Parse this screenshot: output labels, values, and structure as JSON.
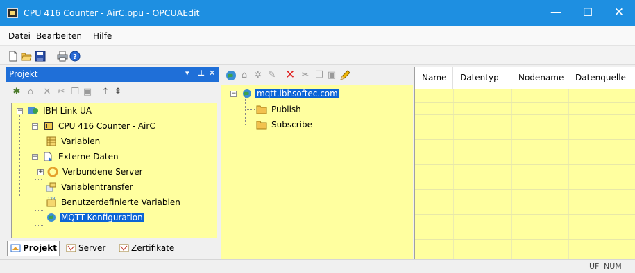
{
  "window": {
    "title": "CPU 416 Counter - AirC.opu - OPCUAEdit",
    "controls": {
      "minimize": "—",
      "maximize": "☐",
      "close": "✕"
    }
  },
  "menu": {
    "items": [
      "Datei",
      "Bearbeiten",
      "Hilfe"
    ]
  },
  "toolbar": {
    "icons": [
      "new-icon",
      "open-icon",
      "save-icon",
      "print-icon",
      "help-icon"
    ]
  },
  "project_pane": {
    "title": "Projekt",
    "header_buttons": [
      "▾",
      "⁴",
      "✕"
    ],
    "tree_toolbar_icons": [
      "new-item-icon",
      "add-folder-icon",
      "delete-icon",
      "cut-icon",
      "copy-icon",
      "paste-icon",
      "up-arrow-icon",
      "root-icon"
    ],
    "tree": [
      {
        "label": "IBH Link UA",
        "icon": "ibh-link-icon"
      },
      {
        "label": "CPU 416 Counter - AirC",
        "icon": "cpu-icon"
      },
      {
        "label": "Variablen",
        "icon": "variables-icon"
      },
      {
        "label": "Externe Daten",
        "icon": "external-data-icon"
      },
      {
        "label": "Verbundene Server",
        "icon": "connected-server-icon"
      },
      {
        "label": "Variablentransfer",
        "icon": "transfer-icon"
      },
      {
        "label": "Benutzerdefinierte Variablen",
        "icon": "custom-variables-icon"
      },
      {
        "label": "MQTT-Konfiguration",
        "icon": "mqtt-icon",
        "selected": true
      }
    ],
    "tabs": [
      {
        "label": "Projekt",
        "icon": "project-tab-icon",
        "active": true
      },
      {
        "label": "Server",
        "icon": "server-tab-icon",
        "active": false
      },
      {
        "label": "Zertifikate",
        "icon": "certificates-tab-icon",
        "active": false
      }
    ]
  },
  "mqtt_pane": {
    "toolbar_icons": [
      "globe-icon",
      "home-icon",
      "network-icon",
      "edit-icon",
      "delete-icon",
      "cut-icon",
      "copy-icon",
      "paste-icon",
      "pencil-icon"
    ],
    "tree": [
      {
        "label": "mqtt.ibhsoftec.com",
        "icon": "globe-icon",
        "selected": true
      },
      {
        "label": "Publish",
        "icon": "folder-icon"
      },
      {
        "label": "Subscribe",
        "icon": "folder-icon"
      }
    ]
  },
  "variables_table": {
    "columns": [
      "Name",
      "Datentyp",
      "Nodename",
      "Datenquelle"
    ],
    "rows": []
  },
  "statusbar": {
    "indicators": [
      "UF",
      "NUM"
    ]
  },
  "colors": {
    "titlebar": "#1e8fe1",
    "selection": "#0a64d6",
    "tree_background": "#ffff9f",
    "pane_header": "#1f6fd8"
  }
}
